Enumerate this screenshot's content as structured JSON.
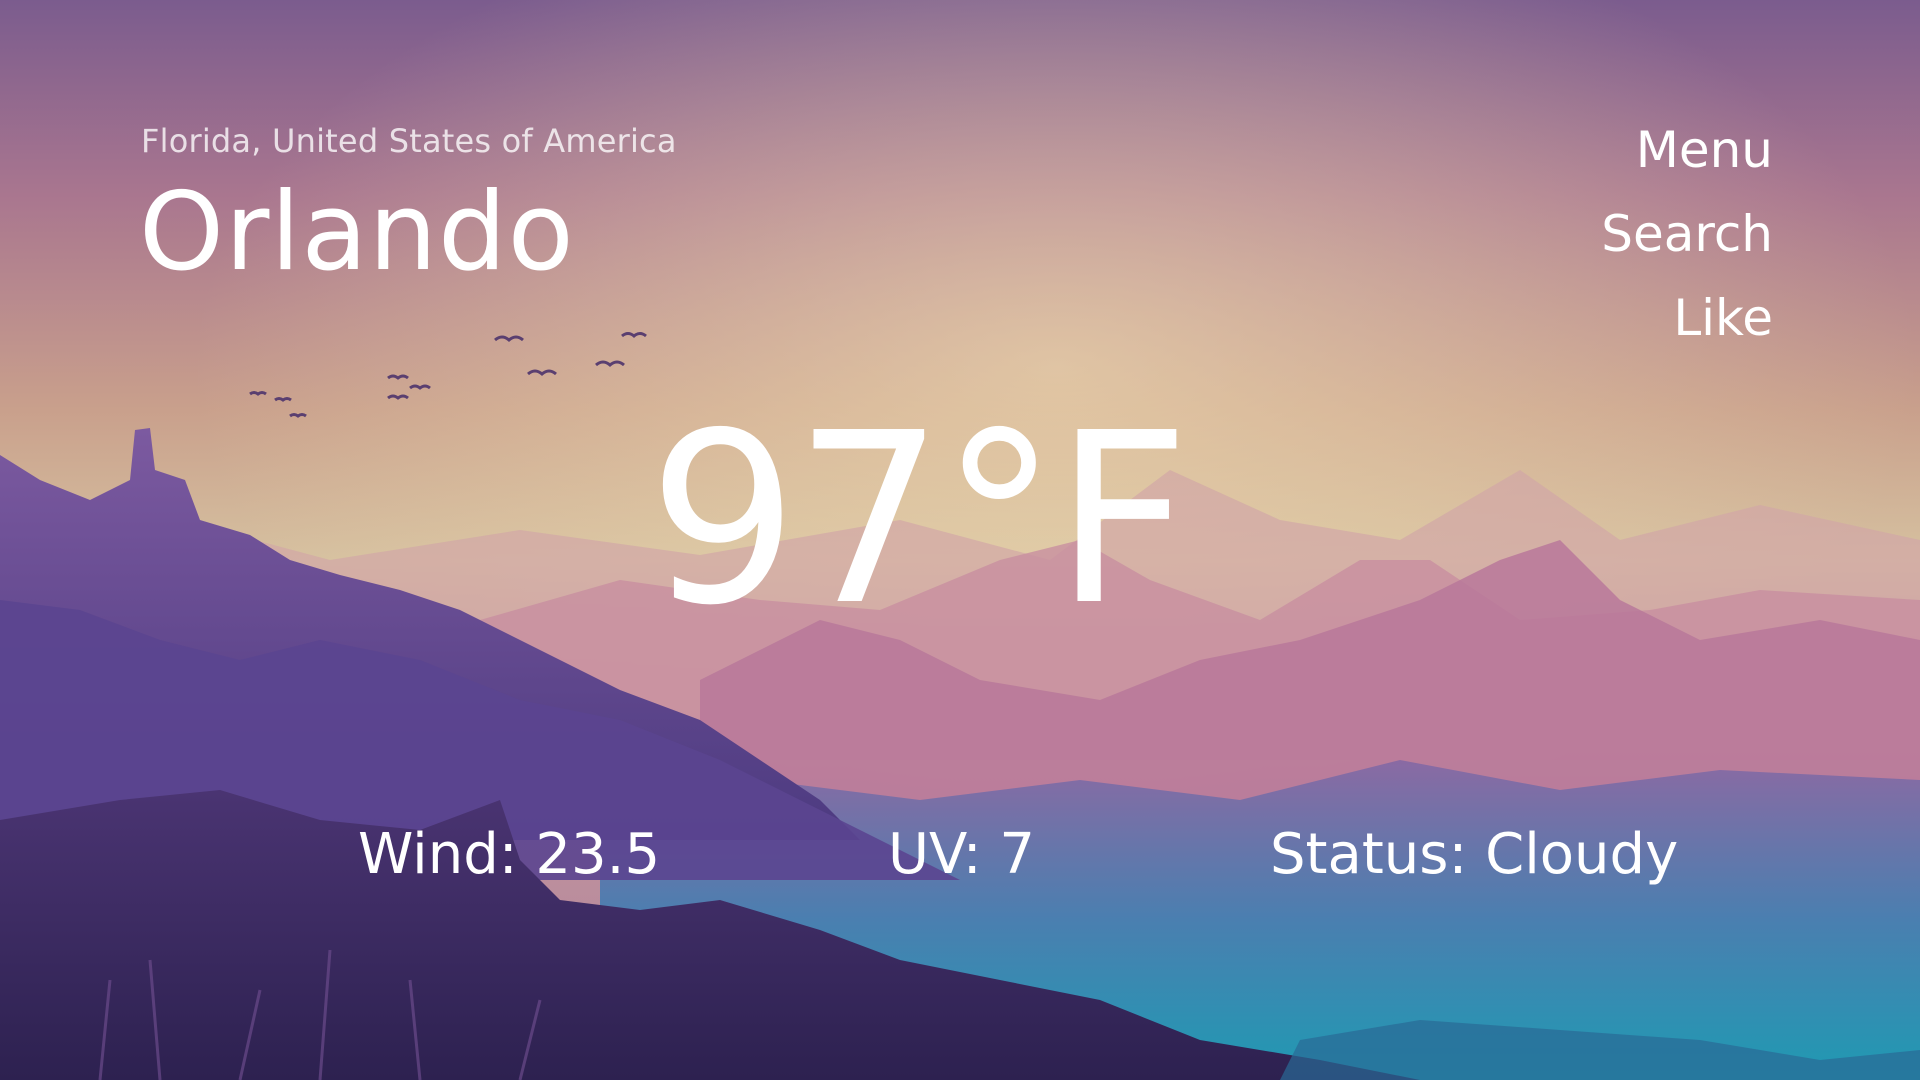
{
  "location": {
    "region": "Florida, United States of America",
    "city": "Orlando"
  },
  "nav": {
    "menu_label": "Menu",
    "search_label": "Search",
    "like_label": "Like"
  },
  "weather": {
    "temperature": "97°F",
    "wind": "Wind: 23.5",
    "uv": "UV: 7",
    "status": "Status: Cloudy"
  },
  "colors": {
    "sky_top": "#7d5f8f",
    "sky_mid": "#c8a28f",
    "horizon": "#d8c8a0",
    "mountain_far": "#c58fa0",
    "hills_purple": "#6a4c94",
    "valley_teal": "#2a8aa8",
    "foreground": "#3a2a5c",
    "text": "#ffffff"
  }
}
